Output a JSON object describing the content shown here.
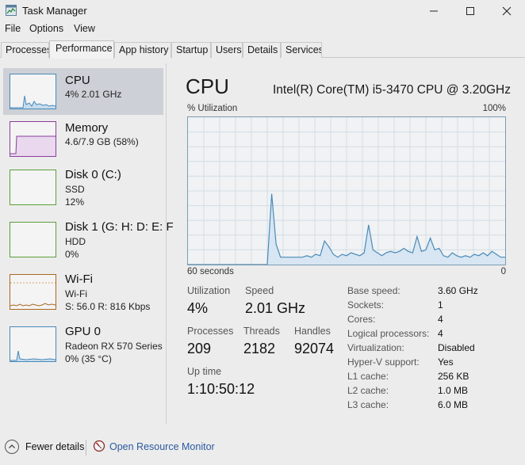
{
  "window": {
    "title": "Task Manager"
  },
  "menu": [
    "File",
    "Options",
    "View"
  ],
  "tabs": [
    "Processes",
    "Performance",
    "App history",
    "Startup",
    "Users",
    "Details",
    "Services"
  ],
  "active_tab": "Performance",
  "sidebar": {
    "items": [
      {
        "name": "CPU",
        "lines": [
          "4% 2.01 GHz"
        ],
        "color": "#4a8ab8"
      },
      {
        "name": "Memory",
        "lines": [
          "4.6/7.9 GB (58%)"
        ],
        "color": "#8a3e9a"
      },
      {
        "name": "Disk 0 (C:)",
        "lines": [
          "SSD",
          "12%"
        ],
        "color": "#5aa03a"
      },
      {
        "name": "Disk 1 (G: H: D: E: F",
        "lines": [
          "HDD",
          "0%"
        ],
        "color": "#5aa03a"
      },
      {
        "name": "Wi-Fi",
        "lines": [
          "Wi-Fi",
          "S: 56.0  R: 816 Kbps"
        ],
        "color": "#a8681e"
      },
      {
        "name": "GPU 0",
        "lines": [
          "Radeon RX 570 Series",
          "0% (35 °C)"
        ],
        "color": "#4a8ab8"
      }
    ]
  },
  "detail": {
    "title": "CPU",
    "model": "Intel(R) Core(TM) i5-3470 CPU @ 3.20GHz",
    "graph": {
      "y_label": "% Utilization",
      "y_max_label": "100%",
      "x_left_label": "60 seconds",
      "x_right_label": "0",
      "line_color": "#4a8ab8",
      "samples_percent": [
        0,
        0,
        0,
        0,
        0,
        0,
        0,
        0,
        0,
        0,
        0,
        0,
        0,
        0,
        0,
        0,
        0,
        0,
        0,
        48,
        14,
        5,
        5,
        5,
        5,
        5,
        5,
        6,
        5,
        7,
        6,
        16,
        12,
        7,
        5,
        7,
        6,
        8,
        7,
        6,
        8,
        27,
        10,
        8,
        6,
        8,
        9,
        8,
        9,
        11,
        9,
        8,
        19,
        9,
        10,
        18,
        10,
        11,
        6,
        5,
        8,
        6,
        5,
        6,
        5,
        7,
        6,
        8,
        6,
        9,
        7,
        5,
        5
      ]
    },
    "stats": {
      "utilization": {
        "label": "Utilization",
        "value": "4%"
      },
      "speed": {
        "label": "Speed",
        "value": "2.01 GHz"
      },
      "processes": {
        "label": "Processes",
        "value": "209"
      },
      "threads": {
        "label": "Threads",
        "value": "2182"
      },
      "handles": {
        "label": "Handles",
        "value": "92074"
      },
      "uptime": {
        "label": "Up time",
        "value": "1:10:50:12"
      }
    },
    "specs": [
      {
        "key": "Base speed:",
        "value": "3.60 GHz"
      },
      {
        "key": "Sockets:",
        "value": "1"
      },
      {
        "key": "Cores:",
        "value": "4"
      },
      {
        "key": "Logical processors:",
        "value": "4"
      },
      {
        "key": "Virtualization:",
        "value": "Disabled"
      },
      {
        "key": "Hyper-V support:",
        "value": "Yes"
      },
      {
        "key": "L1 cache:",
        "value": "256 KB"
      },
      {
        "key": "L2 cache:",
        "value": "1.0 MB"
      },
      {
        "key": "L3 cache:",
        "value": "6.0 MB"
      }
    ]
  },
  "footer": {
    "fewer_details": "Fewer details",
    "resource_monitor": "Open Resource Monitor"
  }
}
